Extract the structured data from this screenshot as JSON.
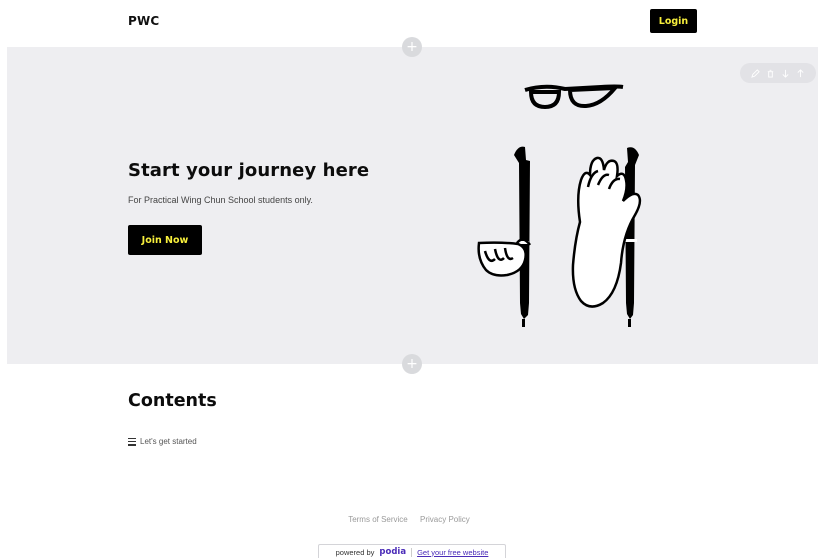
{
  "header": {
    "brand": "PWC",
    "login_label": "Login"
  },
  "add_section": {
    "symbol": "+"
  },
  "hero": {
    "title": "Start your journey here",
    "subtitle": "For Practical Wing Chun School students only.",
    "cta_label": "Join Now",
    "toolbar_icons": [
      "pencil-icon",
      "trash-icon",
      "arrow-down-icon",
      "arrow-up-icon"
    ]
  },
  "contents": {
    "title": "Contents",
    "items": [
      {
        "label": "Let's get started",
        "icon": "list-icon"
      }
    ]
  },
  "footer": {
    "terms": "Terms of Service",
    "privacy": "Privacy Policy",
    "powered_by": "powered by",
    "brand": "podia",
    "free_site": "Get your free website"
  },
  "colors": {
    "accent_text": "#f7ef3c",
    "hero_bg": "#eeeef1",
    "podia_purple": "#4a2bb8"
  }
}
